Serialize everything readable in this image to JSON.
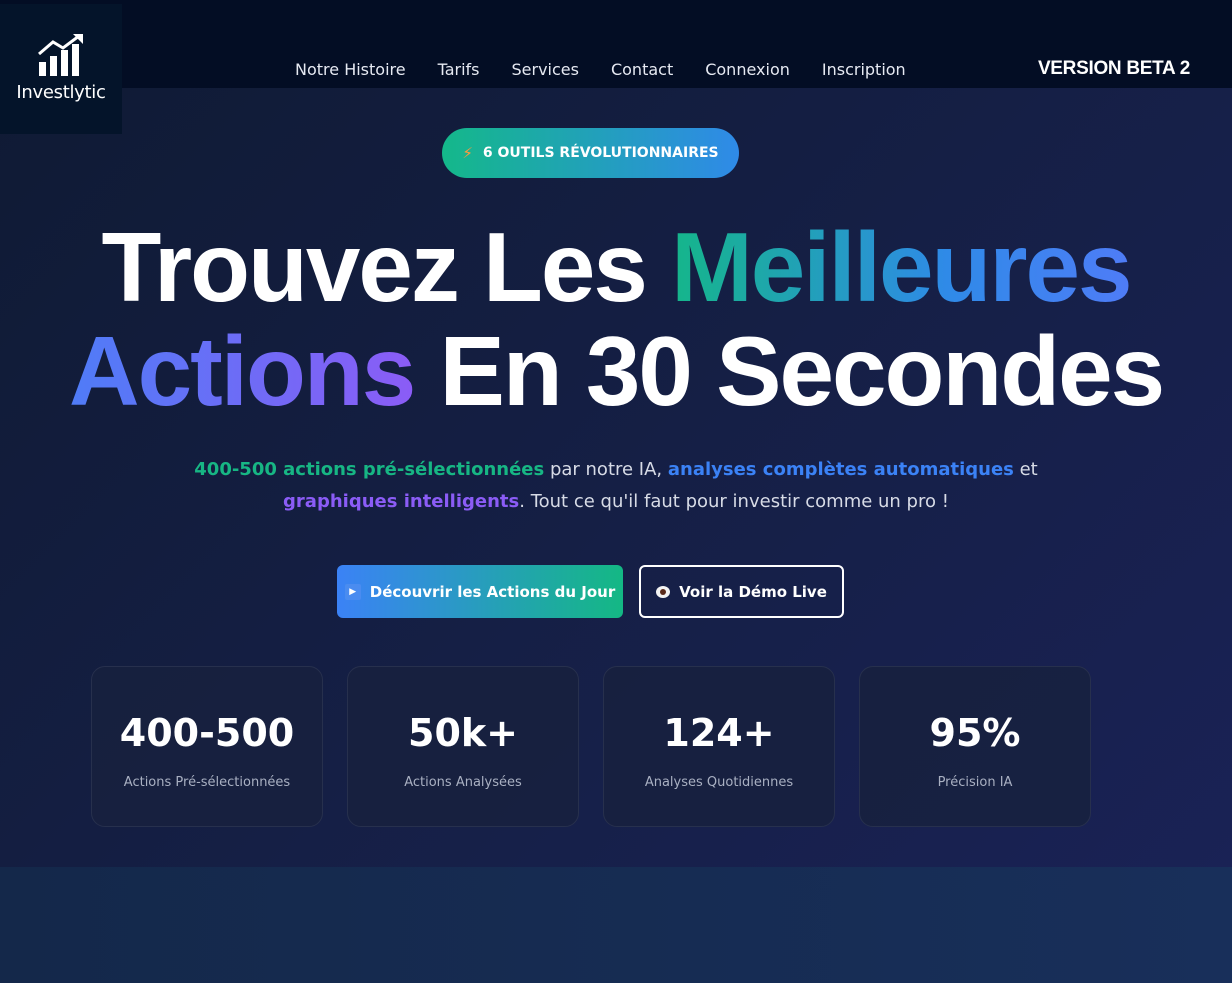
{
  "brand": {
    "name": "Investlytic"
  },
  "nav": {
    "items": [
      "Notre Histoire",
      "Tarifs",
      "Services",
      "Contact",
      "Connexion",
      "Inscription"
    ]
  },
  "version": "VERSION BETA 2",
  "badge": {
    "label": "6 OUTILS RÉVOLUTIONNAIRES",
    "icon": "lightning-icon"
  },
  "headline": {
    "line1_a": "Trouvez Les",
    "line1_b": "Meilleures",
    "line2_a": "Actions",
    "line2_b": "En 30 Secondes"
  },
  "subtitle": {
    "hl1": "400-500 actions pré-sélectionnées",
    "t1": " par notre IA, ",
    "hl2": "analyses complètes automatiques",
    "t2": " et",
    "hl3": "graphiques intelligents",
    "t3": ". Tout ce qu'il faut pour investir comme un pro !"
  },
  "cta": {
    "primary": "Découvrir les Actions du Jour",
    "secondary": "Voir la Démo Live"
  },
  "stats": [
    {
      "value": "400-500",
      "label": "Actions Pré-sélectionnées"
    },
    {
      "value": "50k+",
      "label": "Actions Analysées"
    },
    {
      "value": "124+",
      "label": "Analyses Quotidiennes"
    },
    {
      "value": "95%",
      "label": "Précision IA"
    }
  ],
  "colors": {
    "accent_green": "#17b684",
    "accent_blue": "#3b82f6",
    "accent_purple": "#8b5cf6",
    "background": "#151f45"
  }
}
